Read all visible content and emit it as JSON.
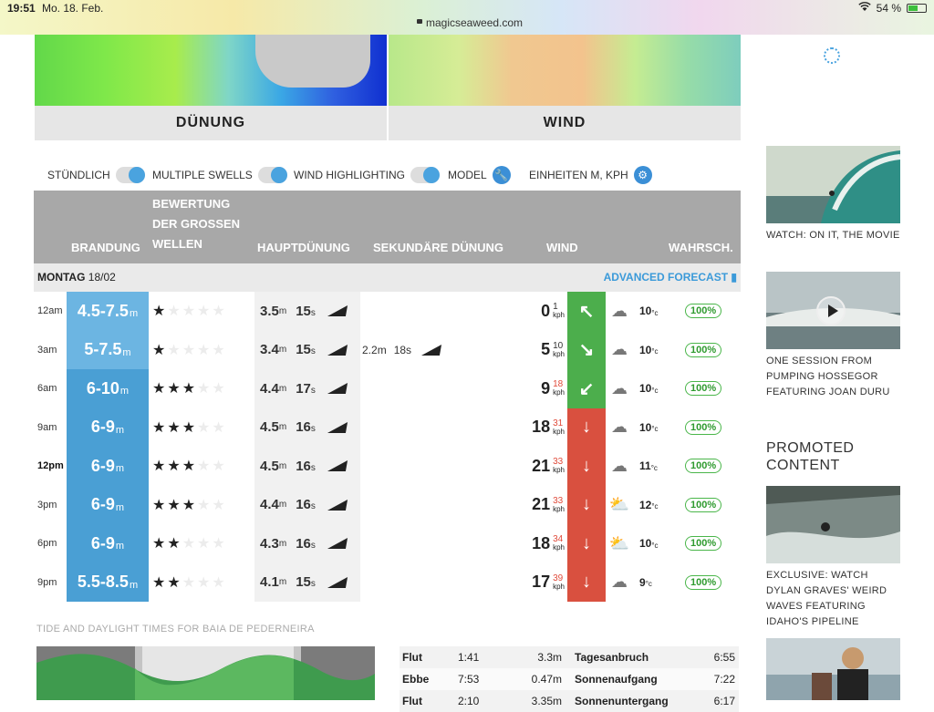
{
  "status": {
    "time": "19:51",
    "date": "Mo. 18. Feb.",
    "url": "magicseaweed.com",
    "battery": "54 %",
    "battery_level": 0.54
  },
  "maps": {
    "swell_label": "DÜNUNG",
    "wind_label": "WIND"
  },
  "toggles": {
    "hourly": "STÜNDLICH",
    "multiple_swells": "MULTIPLE SWELLS",
    "wind_highlighting": "WIND HIGHLIGHTING",
    "model": "MODEL",
    "units": "EINHEITEN M, KPH"
  },
  "table": {
    "headers": {
      "surf": "BRANDUNG",
      "rating": "BEWERTUNG DER GROSSEN WELLEN",
      "primary": "HAUPTDÜNUNG",
      "secondary": "SEKUNDÄRE DÜNUNG",
      "wind": "WIND",
      "prob": "WAHRSCH."
    },
    "day_label": "MONTAG",
    "day_date": "18/02",
    "advanced": "ADVANCED FORECAST",
    "rows": [
      {
        "time": "12am",
        "surf": "4.5-7.5",
        "unit": "m",
        "stars": 1,
        "h": "3.5",
        "p": "15",
        "sec_h": "",
        "sec_p": "",
        "wind": "0",
        "gust": "1",
        "wind_color": "#4cae4c",
        "arrow": "↖",
        "weather": "☁",
        "temp": "10",
        "prob": "100%"
      },
      {
        "time": "3am",
        "surf": "5-7.5",
        "unit": "m",
        "stars": 1,
        "h": "3.4",
        "p": "15",
        "sec_h": "2.2",
        "sec_p": "18",
        "wind": "5",
        "gust": "10",
        "wind_color": "#4cae4c",
        "arrow": "↘",
        "weather": "☁",
        "temp": "10",
        "prob": "100%"
      },
      {
        "time": "6am",
        "surf": "6-10",
        "unit": "m",
        "stars": 3,
        "h": "4.4",
        "p": "17",
        "sec_h": "",
        "sec_p": "",
        "wind": "9",
        "gust": "18",
        "wind_color": "#4cae4c",
        "arrow": "↙",
        "weather": "☁",
        "temp": "10",
        "prob": "100%"
      },
      {
        "time": "9am",
        "surf": "6-9",
        "unit": "m",
        "stars": 3,
        "h": "4.5",
        "p": "16",
        "sec_h": "",
        "sec_p": "",
        "wind": "18",
        "gust": "31",
        "wind_color": "#d9503f",
        "arrow": "↓",
        "weather": "☁",
        "temp": "10",
        "prob": "100%"
      },
      {
        "time": "12pm",
        "surf": "6-9",
        "unit": "m",
        "stars": 3,
        "h": "4.5",
        "p": "16",
        "sec_h": "",
        "sec_p": "",
        "wind": "21",
        "gust": "33",
        "wind_color": "#d9503f",
        "arrow": "↓",
        "weather": "☁",
        "temp": "11",
        "prob": "100%"
      },
      {
        "time": "3pm",
        "surf": "6-9",
        "unit": "m",
        "stars": 3,
        "h": "4.4",
        "p": "16",
        "sec_h": "",
        "sec_p": "",
        "wind": "21",
        "gust": "33",
        "wind_color": "#d9503f",
        "arrow": "↓",
        "weather": "⛅",
        "temp": "12",
        "prob": "100%"
      },
      {
        "time": "6pm",
        "surf": "6-9",
        "unit": "m",
        "stars": 2,
        "h": "4.3",
        "p": "16",
        "sec_h": "",
        "sec_p": "",
        "wind": "18",
        "gust": "34",
        "wind_color": "#d9503f",
        "arrow": "↓",
        "weather": "⛅",
        "temp": "10",
        "prob": "100%"
      },
      {
        "time": "9pm",
        "surf": "5.5-8.5",
        "unit": "m",
        "stars": 2,
        "h": "4.1",
        "p": "15",
        "sec_h": "",
        "sec_p": "",
        "wind": "17",
        "gust": "39",
        "wind_color": "#d9503f",
        "arrow": "↓",
        "weather": "☁",
        "temp": "9",
        "prob": "100%"
      }
    ],
    "units": {
      "height": "m",
      "period": "s",
      "speed": "kph",
      "temp": "°c"
    }
  },
  "tide": {
    "label": "TIDE AND DAYLIGHT TIMES FOR BAIA DE PEDERNEIRA",
    "rows": [
      {
        "type": "Flut",
        "time": "1:41",
        "height": "3.3m",
        "sun_label": "Tagesanbruch",
        "sun_time": "6:55"
      },
      {
        "type": "Ebbe",
        "time": "7:53",
        "height": "0.47m",
        "sun_label": "Sonnenaufgang",
        "sun_time": "7:22"
      },
      {
        "type": "Flut",
        "time": "2:10",
        "height": "3.35m",
        "sun_label": "Sonnenuntergang",
        "sun_time": "6:17"
      }
    ]
  },
  "sidebar": {
    "items": [
      {
        "caption": "WATCH: ON IT, THE MOVIE"
      },
      {
        "caption": "ONE SESSION FROM PUMPING HOSSEGOR FEATURING JOAN DURU"
      },
      {
        "caption": "EXCLUSIVE: WATCH DYLAN GRAVES' WEIRD WAVES FEATURING IDAHO'S PIPELINE"
      }
    ],
    "promoted": "PROMOTED CONTENT"
  }
}
